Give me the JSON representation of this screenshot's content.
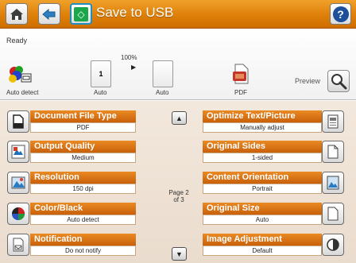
{
  "header": {
    "title": "Save to USB",
    "home_icon": "home-icon",
    "back_icon": "back-arrow-icon",
    "start_icon": "start-icon",
    "help_label": "?"
  },
  "status": {
    "ready": "Ready",
    "zoom": "100%",
    "color_mode": "Auto detect",
    "page1_number": "1",
    "page1_label": "Auto",
    "page2_label": "Auto",
    "format_label": "PDF",
    "preview_label": "Preview"
  },
  "options": {
    "document_file_type": {
      "title": "Document File Type",
      "value": "PDF"
    },
    "output_quality": {
      "title": "Output Quality",
      "value": "Medium"
    },
    "resolution": {
      "title": "Resolution",
      "value": "150 dpi"
    },
    "color_black": {
      "title": "Color/Black",
      "value": "Auto detect"
    },
    "notification": {
      "title": "Notification",
      "value": "Do not notify"
    },
    "optimize": {
      "title": "Optimize Text/Picture",
      "value": "Manually adjust"
    },
    "original_sides": {
      "title": "Original Sides",
      "value": "1-sided"
    },
    "content_orientation": {
      "title": "Content Orientation",
      "value": "Portrait"
    },
    "original_size": {
      "title": "Original Size",
      "value": "Auto"
    },
    "image_adjustment": {
      "title": "Image Adjustment",
      "value": "Default"
    }
  },
  "pager": {
    "line1": "Page 2",
    "line2": "of 3"
  },
  "colors": {
    "accent": "#dd7f09",
    "option_header": "#d66f13",
    "panel": "#f0e3d6"
  }
}
